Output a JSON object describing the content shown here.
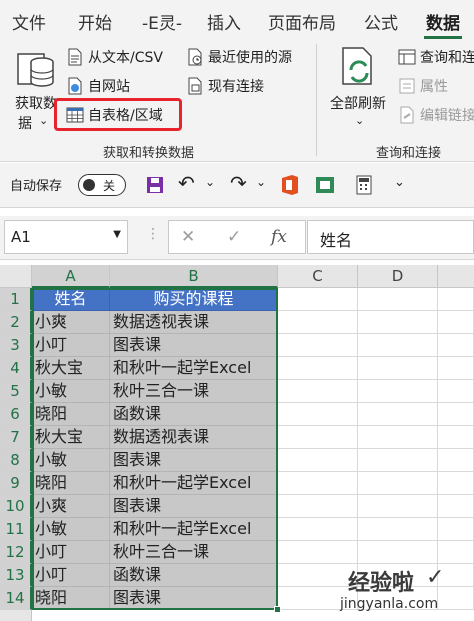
{
  "tabs": [
    "文件",
    "开始",
    "-E灵-",
    "插入",
    "页面布局",
    "公式",
    "数据"
  ],
  "ribbon": {
    "get_data_label_1": "获取数",
    "get_data_label_2": "据",
    "from_text_csv": "从文本/CSV",
    "from_web": "自网站",
    "from_table": "自表格/区域",
    "recent_sources": "最近使用的源",
    "existing_connections": "现有连接",
    "group_get_transform": "获取和转换数据",
    "refresh_all": "全部刷新",
    "queries_connections": "查询和连接",
    "properties": "属性",
    "edit_links": "编辑链接",
    "group_queries": "查询和连接"
  },
  "qat": {
    "autosave_label": "自动保存",
    "toggle_state": "关"
  },
  "formula_bar": {
    "name_box": "A1",
    "formula": "姓名"
  },
  "sheet": {
    "columns": [
      "A",
      "B",
      "C",
      "D"
    ],
    "rows": [
      {
        "n": "1",
        "a": "姓名",
        "b": "购买的课程"
      },
      {
        "n": "2",
        "a": "小爽",
        "b": "数据透视表课"
      },
      {
        "n": "3",
        "a": "小叮",
        "b": "图表课"
      },
      {
        "n": "4",
        "a": "秋大宝",
        "b": "和秋叶一起学Excel"
      },
      {
        "n": "5",
        "a": "小敏",
        "b": "秋叶三合一课"
      },
      {
        "n": "6",
        "a": "晓阳",
        "b": "函数课"
      },
      {
        "n": "7",
        "a": "秋大宝",
        "b": "数据透视表课"
      },
      {
        "n": "8",
        "a": "小敏",
        "b": "图表课"
      },
      {
        "n": "9",
        "a": "晓阳",
        "b": "和秋叶一起学Excel"
      },
      {
        "n": "10",
        "a": "小爽",
        "b": "图表课"
      },
      {
        "n": "11",
        "a": "小敏",
        "b": "和秋叶一起学Excel"
      },
      {
        "n": "12",
        "a": "小叮",
        "b": "秋叶三合一课"
      },
      {
        "n": "13",
        "a": "小叮",
        "b": "函数课"
      },
      {
        "n": "14",
        "a": "晓阳",
        "b": "图表课"
      }
    ]
  },
  "watermark": {
    "text": "经验啦",
    "url": "jingyanla.com"
  },
  "colors": {
    "accent": "#217346",
    "header_fill": "#4472c4",
    "highlight": "#e8232d"
  }
}
